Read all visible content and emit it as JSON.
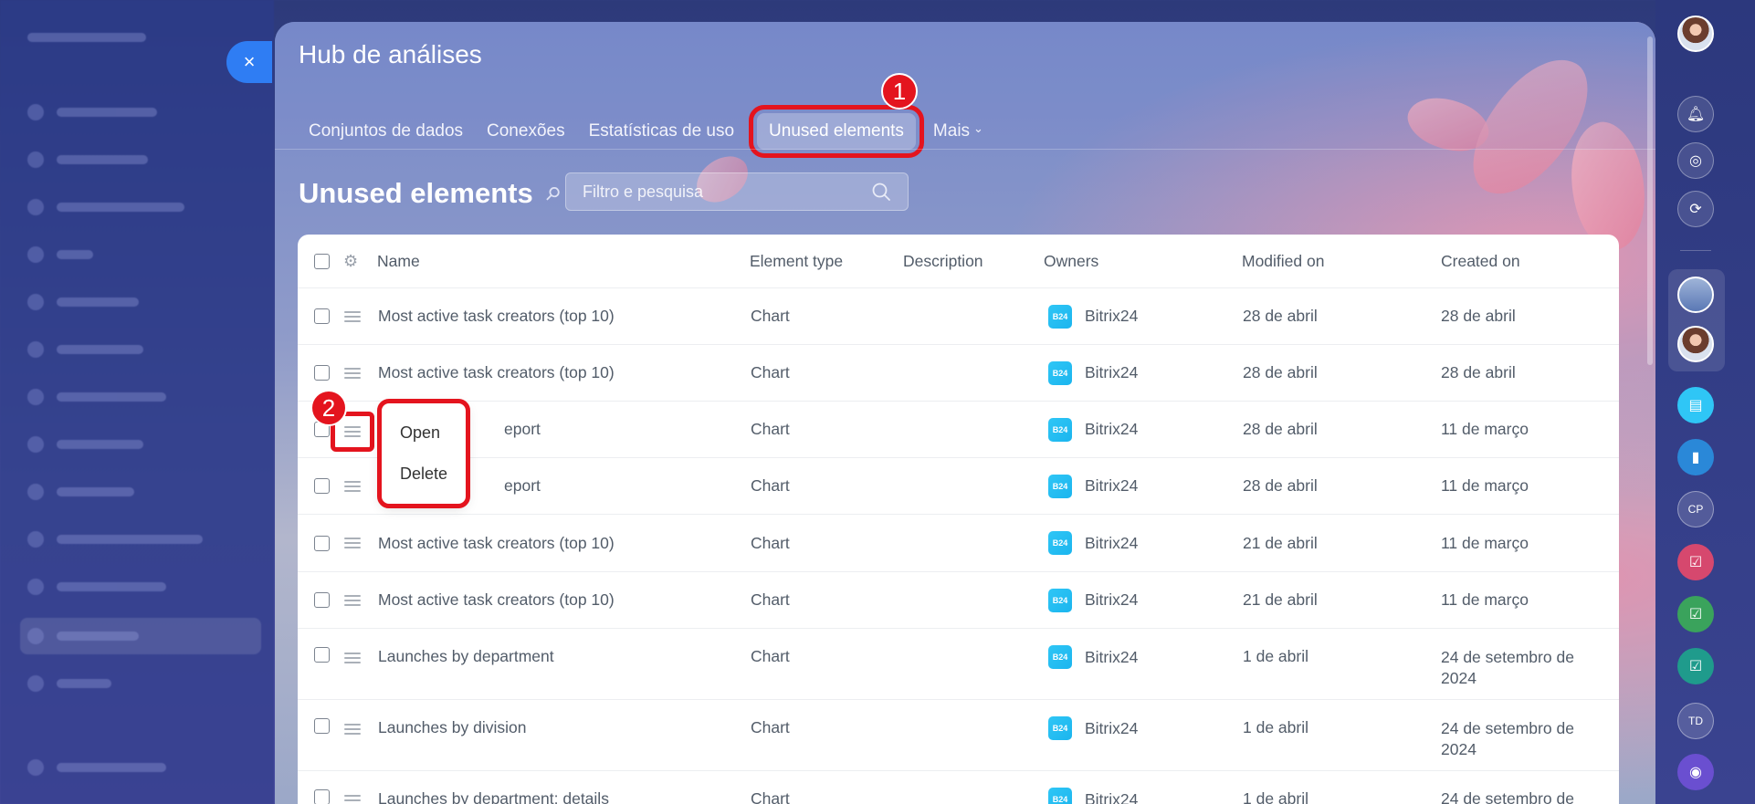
{
  "panel": {
    "title": "Hub de análises",
    "close_glyph": "×"
  },
  "tabs": [
    {
      "label": "Conjuntos de dados",
      "active": false
    },
    {
      "label": "Conexões",
      "active": false
    },
    {
      "label": "Estatísticas de uso",
      "active": false
    },
    {
      "label": "Unused elements",
      "active": true
    },
    {
      "label": "Mais",
      "active": false
    }
  ],
  "more_chevron": "⌄",
  "annotations": {
    "badge1": "1",
    "badge2": "2",
    "color": "#e4141e"
  },
  "page": {
    "heading": "Unused elements",
    "pin_icon": "pin-icon",
    "search_placeholder": "Filtro e pesquisa"
  },
  "table": {
    "columns": [
      "Name",
      "Element type",
      "Description",
      "Owners",
      "Modified on",
      "Created on"
    ],
    "rows": [
      {
        "name": "Most active task creators (top 10)",
        "type": "Chart",
        "description": "",
        "owner": "Bitrix24",
        "modified": "28 de abril",
        "created": "28 de abril"
      },
      {
        "name": "Most active task creators (top 10)",
        "type": "Chart",
        "description": "",
        "owner": "Bitrix24",
        "modified": "28 de abril",
        "created": "28 de abril"
      },
      {
        "name": "eport",
        "type": "Chart",
        "description": "",
        "owner": "Bitrix24",
        "modified": "28 de abril",
        "created": "11 de março"
      },
      {
        "name": "eport",
        "type": "Chart",
        "description": "",
        "owner": "Bitrix24",
        "modified": "28 de abril",
        "created": "11 de março"
      },
      {
        "name": "Most active task creators (top 10)",
        "type": "Chart",
        "description": "",
        "owner": "Bitrix24",
        "modified": "21 de abril",
        "created": "11 de março"
      },
      {
        "name": "Most active task creators (top 10)",
        "type": "Chart",
        "description": "",
        "owner": "Bitrix24",
        "modified": "21 de abril",
        "created": "11 de março"
      },
      {
        "name": "Launches by department",
        "type": "Chart",
        "description": "",
        "owner": "Bitrix24",
        "modified": "1 de abril",
        "created": "24 de setembro de 2024"
      },
      {
        "name": "Launches by division",
        "type": "Chart",
        "description": "",
        "owner": "Bitrix24",
        "modified": "1 de abril",
        "created": "24 de setembro de 2024"
      },
      {
        "name": "Launches by department: details",
        "type": "Chart",
        "description": "",
        "owner": "Bitrix24",
        "modified": "1 de abril",
        "created": "24 de setembro de"
      }
    ],
    "owner_logo_text": "B24"
  },
  "context_menu": {
    "items": [
      "Open",
      "Delete"
    ]
  },
  "right_rail": {
    "initials_1": "CP",
    "initials_2": "TD"
  }
}
